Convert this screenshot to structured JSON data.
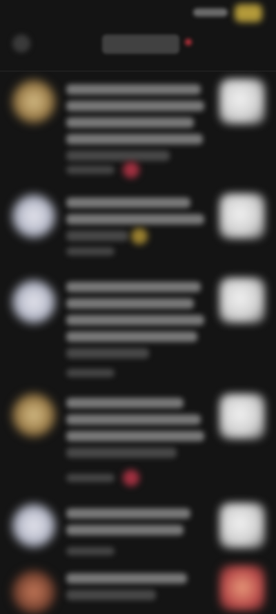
{
  "status_bar": {
    "time": "",
    "battery": ""
  },
  "header": {
    "title": ""
  },
  "feed": {
    "items": [
      {
        "avatar": "gold-avatar",
        "lines": [
          "",
          "",
          "",
          "",
          "",
          ""
        ],
        "meta": "",
        "reaction": "red",
        "thumbnail": "white"
      },
      {
        "avatar": "silver-avatar",
        "lines": [
          "",
          "",
          "",
          ""
        ],
        "meta": "",
        "reaction": "gold",
        "thumbnail": "white"
      },
      {
        "avatar": "silver-avatar",
        "lines": [
          "",
          "",
          "",
          "",
          "",
          ""
        ],
        "meta": "",
        "reaction": "",
        "thumbnail": "white"
      },
      {
        "avatar": "gold-avatar",
        "lines": [
          "",
          "",
          "",
          "",
          ""
        ],
        "meta": "",
        "reaction": "red",
        "thumbnail": "white"
      },
      {
        "avatar": "silver-avatar",
        "lines": [
          "",
          "",
          ""
        ],
        "meta": "",
        "reaction": "",
        "thumbnail": "white"
      },
      {
        "avatar": "pink-avatar",
        "lines": [
          "",
          ""
        ],
        "meta": "",
        "reaction": "",
        "thumbnail": "color"
      }
    ]
  },
  "colors": {
    "background": "#141414",
    "accent_red": "#a03040",
    "accent_gold": "#9a8030"
  }
}
